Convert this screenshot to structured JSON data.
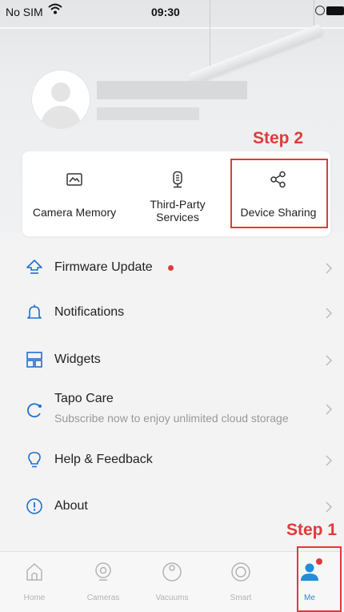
{
  "status_bar": {
    "carrier": "No SIM",
    "time": "09:30",
    "icons": [
      "wifi-icon",
      "alarm-icon",
      "battery-icon"
    ]
  },
  "profile": {
    "avatar": "default-avatar-icon",
    "name": "",
    "email": ""
  },
  "annotations": {
    "step2": "Step 2",
    "step1": "Step 1",
    "color": "#e03a3a"
  },
  "quick_actions": [
    {
      "icon": "camera-memory-icon",
      "label": "Camera Memory"
    },
    {
      "icon": "third-party-services-icon",
      "label": "Third-Party\nServices",
      "label_line1": "Third-Party",
      "label_line2": "Services"
    },
    {
      "icon": "share-icon",
      "label": "Device Sharing"
    }
  ],
  "settings": [
    {
      "icon": "firmware-update-icon",
      "label": "Firmware Update",
      "has_badge": true
    },
    {
      "icon": "bell-icon",
      "label": "Notifications"
    },
    {
      "icon": "widgets-icon",
      "label": "Widgets"
    },
    {
      "icon": "tapo-care-icon",
      "label": "Tapo Care",
      "subtitle": "Subscribe now to enjoy unlimited cloud storage"
    },
    {
      "icon": "lightbulb-icon",
      "label": "Help & Feedback"
    },
    {
      "icon": "info-icon",
      "label": "About"
    }
  ],
  "tab_bar": {
    "active": "Me",
    "accent_color": "#1f8fd8",
    "tabs": [
      {
        "icon": "home-icon",
        "label": "Home"
      },
      {
        "icon": "camera-icon",
        "label": "Cameras"
      },
      {
        "icon": "vacuum-icon",
        "label": "Vacuums"
      },
      {
        "icon": "smart-icon",
        "label": "Smart"
      },
      {
        "icon": "me-icon",
        "label": "Me",
        "has_badge": true
      }
    ]
  }
}
